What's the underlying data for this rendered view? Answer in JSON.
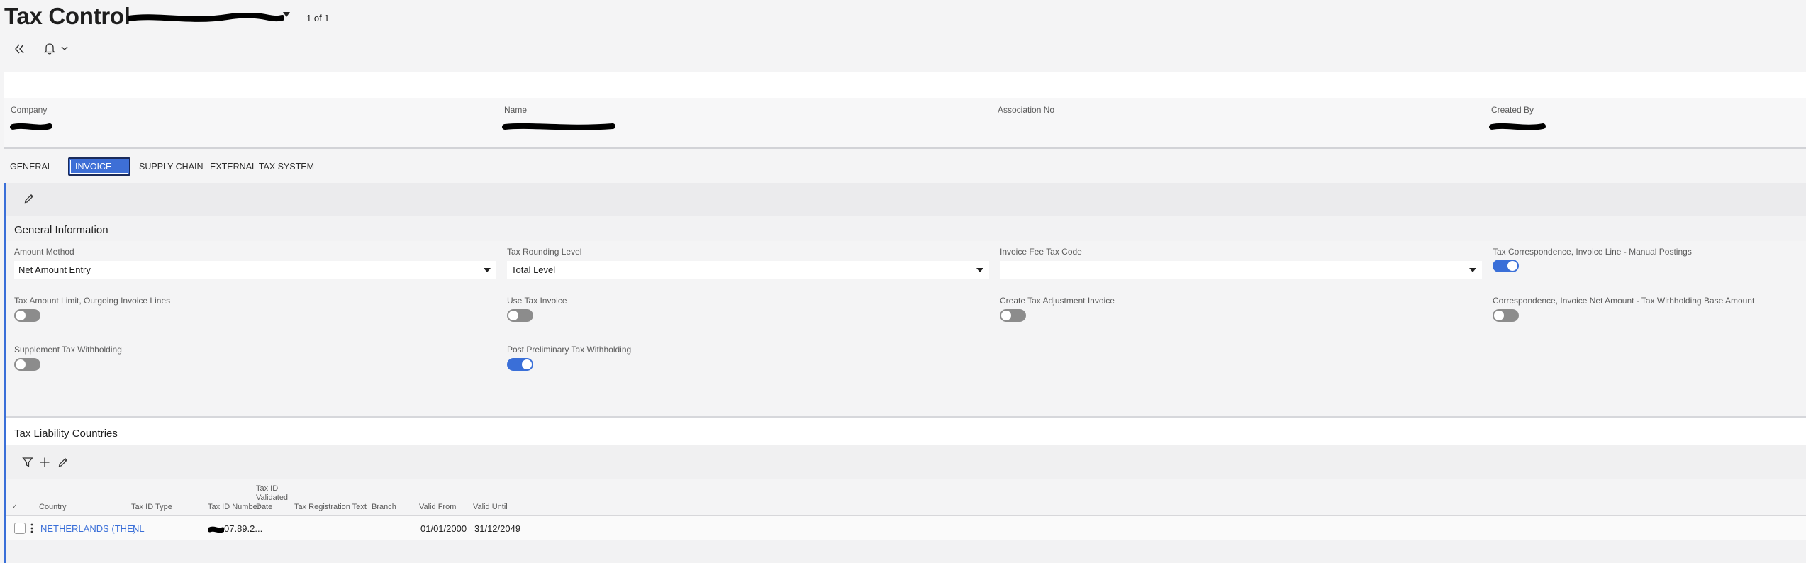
{
  "page": {
    "title": "Tax Control",
    "record_counter": "1 of 1"
  },
  "header_fields": [
    {
      "label": "Company"
    },
    {
      "label": "Name"
    },
    {
      "label": "Association No"
    },
    {
      "label": "Created By"
    }
  ],
  "tabs": [
    {
      "label": "GENERAL",
      "active": false
    },
    {
      "label": "INVOICE",
      "active": true
    },
    {
      "label": "SUPPLY CHAIN",
      "active": false
    },
    {
      "label": "EXTERNAL TAX SYSTEM",
      "active": false
    }
  ],
  "general_information": {
    "title": "General Information",
    "amount_method": {
      "label": "Amount Method",
      "value": "Net Amount Entry"
    },
    "tax_rounding_level": {
      "label": "Tax Rounding Level",
      "value": "Total Level"
    },
    "invoice_fee_tax_code": {
      "label": "Invoice Fee Tax Code",
      "value": ""
    },
    "tax_correspondence_manual": {
      "label": "Tax Correspondence, Invoice Line - Manual Postings",
      "on": true
    },
    "tax_amount_limit": {
      "label": "Tax Amount Limit, Outgoing Invoice Lines",
      "on": false
    },
    "use_tax_invoice": {
      "label": "Use Tax Invoice",
      "on": false
    },
    "create_tax_adjustment_invoice": {
      "label": "Create Tax Adjustment Invoice",
      "on": false
    },
    "correspondence_net_withholding": {
      "label": "Correspondence, Invoice Net Amount - Tax Withholding Base Amount",
      "on": false
    },
    "supplement_tax_withholding": {
      "label": "Supplement Tax Withholding",
      "on": false
    },
    "post_preliminary_tax_withholding": {
      "label": "Post Preliminary Tax Withholding",
      "on": true
    }
  },
  "tax_liability": {
    "title": "Tax Liability Countries",
    "columns": {
      "select": "✓",
      "country": "Country",
      "tax_id_type": "Tax ID Type",
      "tax_id_number": "Tax ID Number",
      "tax_id_validated_date_1": "Tax ID",
      "tax_id_validated_date_2": "Validated",
      "tax_id_validated_date_3": "Date",
      "tax_registration_text": "Tax Registration Text",
      "branch": "Branch",
      "valid_from": "Valid From",
      "valid_until": "Valid Until"
    },
    "rows": [
      {
        "country": "NETHERLANDS (THE)",
        "tax_id_type": "NL",
        "tax_id_number_visible": "07.89.2...",
        "tax_id_validated_date": "",
        "tax_registration_text": "",
        "branch": "",
        "valid_from": "01/01/2000",
        "valid_until": "31/12/2049"
      }
    ]
  },
  "colors": {
    "accent": "#3a6fd8",
    "redaction": "#000000"
  }
}
